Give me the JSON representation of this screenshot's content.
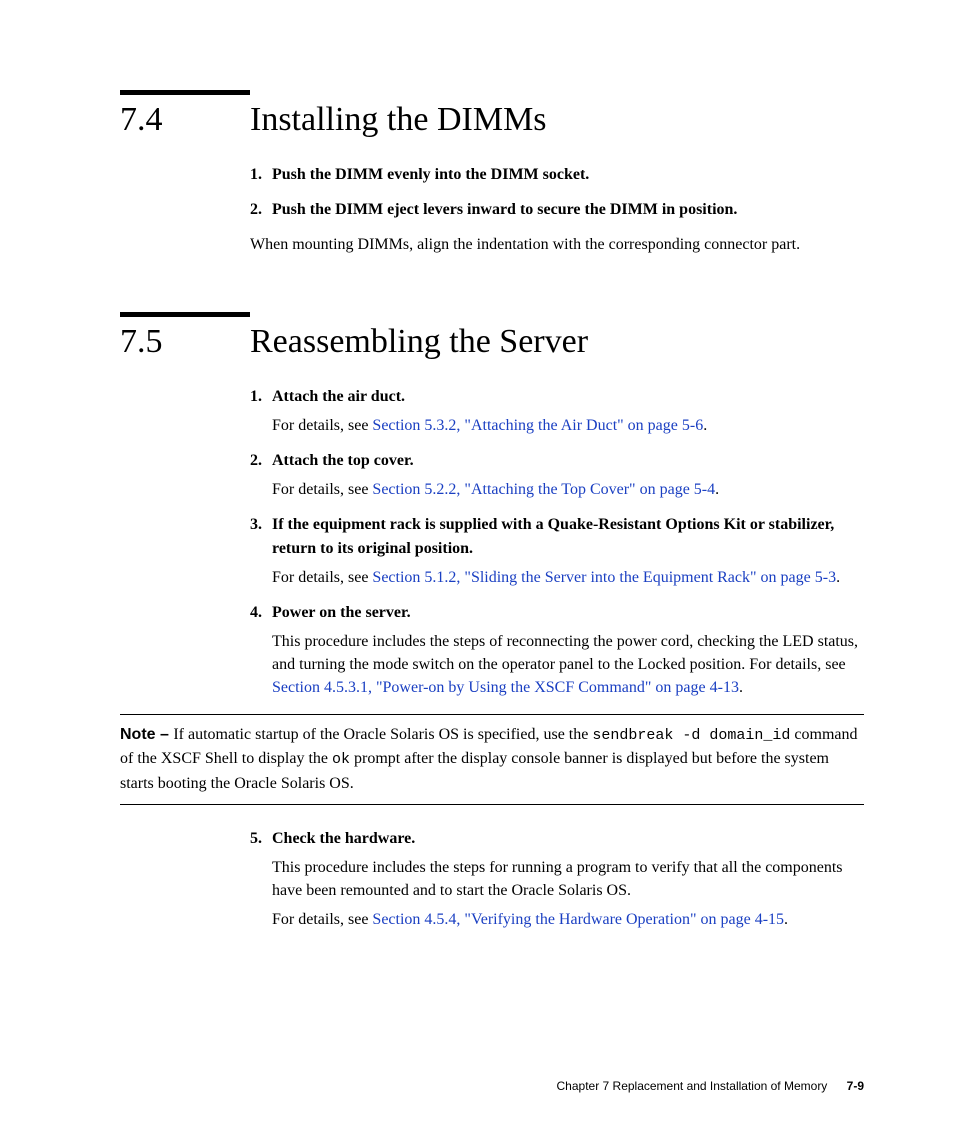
{
  "section74": {
    "number": "7.4",
    "title": "Installing the DIMMs",
    "steps": [
      {
        "num": "1.",
        "title": "Push the DIMM evenly into the DIMM socket."
      },
      {
        "num": "2.",
        "title": "Push the DIMM eject levers inward to secure the DIMM in position."
      }
    ],
    "para": "When mounting DIMMs, align the indentation with the corresponding connector part."
  },
  "section75": {
    "number": "7.5",
    "title": "Reassembling the Server",
    "steps1": [
      {
        "num": "1.",
        "title": "Attach the air duct.",
        "prefix": "For details, see ",
        "link": "Section 5.3.2, \"Attaching the Air Duct\" on page 5-6",
        "suffix": "."
      },
      {
        "num": "2.",
        "title": "Attach the top cover.",
        "prefix": "For details, see ",
        "link": "Section 5.2.2, \"Attaching the Top Cover\" on page 5-4",
        "suffix": "."
      },
      {
        "num": "3.",
        "title": "If the equipment rack is supplied with a Quake-Resistant Options Kit or stabilizer, return to its original position.",
        "prefix": "For details, see ",
        "link": "Section 5.1.2, \"Sliding the Server into the Equipment Rack\" on page 5-3",
        "suffix": "."
      },
      {
        "num": "4.",
        "title": "Power on the server.",
        "prefix": "This procedure includes the steps of reconnecting the power cord, checking the LED status, and turning the mode switch on the operator panel to the Locked position. For details, see ",
        "link": "Section 4.5.3.1, \"Power-on by Using the XSCF Command\" on page 4-13",
        "suffix": "."
      }
    ],
    "note": {
      "label": "Note – ",
      "t1": "If automatic startup of the Oracle Solaris OS is specified, use the ",
      "c1": "sendbreak -d domain_id",
      "t2": " command of the XSCF Shell to display the ",
      "c2": "ok",
      "t3": " prompt after the display console banner is displayed but before the system starts booting the Oracle Solaris OS."
    },
    "steps2": [
      {
        "num": "5.",
        "title": "Check the hardware.",
        "detail1": "This procedure includes the steps for running a program to verify that all the components have been remounted and to start the Oracle Solaris OS.",
        "prefix": "For details, see ",
        "link": "Section 4.5.4, \"Verifying the Hardware Operation\" on page 4-15",
        "suffix": "."
      }
    ]
  },
  "footer": {
    "chapter": "Chapter 7    Replacement and Installation of Memory",
    "page": "7-9"
  }
}
